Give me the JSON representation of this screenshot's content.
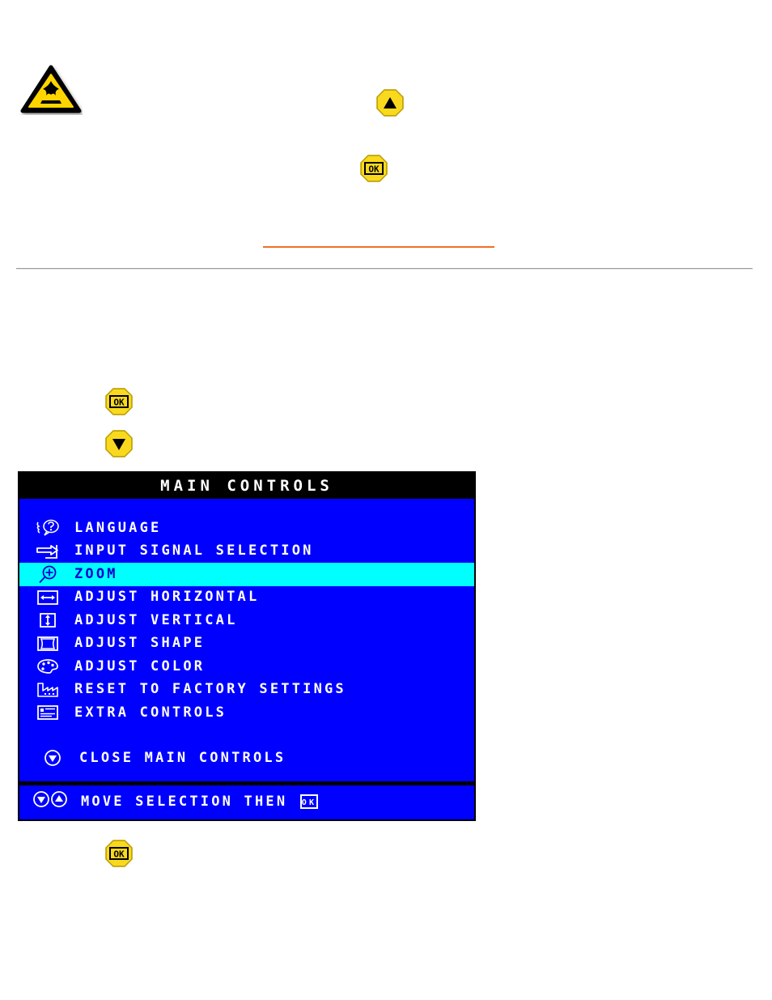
{
  "page": {
    "background": "#ffffff",
    "accent_orange": "#f26f21",
    "rule_color": "#9a9a9a"
  },
  "icons": {
    "warning": {
      "name": "warning-triangle-icon",
      "fill": "#ffd500",
      "stroke": "#000000"
    },
    "osd_button_fill": "#f2cc0c",
    "osd_button_stroke": "#b89a00",
    "osd_button_glyph": "#000000"
  },
  "buttons": {
    "up": {
      "label": "up-arrow-button",
      "glyph": "▲"
    },
    "down": {
      "label": "down-arrow-button",
      "glyph": "▼"
    },
    "ok": {
      "label": "ok-button",
      "glyph": "OK"
    }
  },
  "osd": {
    "title": "MAIN CONTROLS",
    "colors": {
      "background": "#0000ff",
      "title_bar": "#000000",
      "title_text": "#ffffff",
      "text": "#ffffff",
      "highlight_bg": "#00ffff",
      "highlight_text": "#0000cc",
      "border": "#000000"
    },
    "items": [
      {
        "icon": "language-balloon-icon",
        "label": "LANGUAGE",
        "selected": false
      },
      {
        "icon": "input-signal-arrow-icon",
        "label": "INPUT SIGNAL SELECTION",
        "selected": false
      },
      {
        "icon": "zoom-magnifier-plus-icon",
        "label": "ZOOM",
        "selected": true
      },
      {
        "icon": "adjust-horizontal-icon",
        "label": "ADJUST HORIZONTAL",
        "selected": false
      },
      {
        "icon": "adjust-vertical-icon",
        "label": "ADJUST VERTICAL",
        "selected": false
      },
      {
        "icon": "adjust-shape-icon",
        "label": "ADJUST SHAPE",
        "selected": false
      },
      {
        "icon": "adjust-color-palette-icon",
        "label": "ADJUST COLOR",
        "selected": false
      },
      {
        "icon": "factory-reset-icon",
        "label": "RESET TO FACTORY SETTINGS",
        "selected": false
      },
      {
        "icon": "extra-controls-list-icon",
        "label": "EXTRA CONTROLS",
        "selected": false
      }
    ],
    "close_row": {
      "icon": "down-arrow-circle-icon",
      "label": "CLOSE MAIN CONTROLS"
    },
    "footer": {
      "icon_down": "down-arrow-circle-icon",
      "icon_up": "up-arrow-circle-icon",
      "label": "MOVE SELECTION THEN",
      "ok_icon": "ok-key-icon",
      "ok_text": "OK"
    }
  }
}
